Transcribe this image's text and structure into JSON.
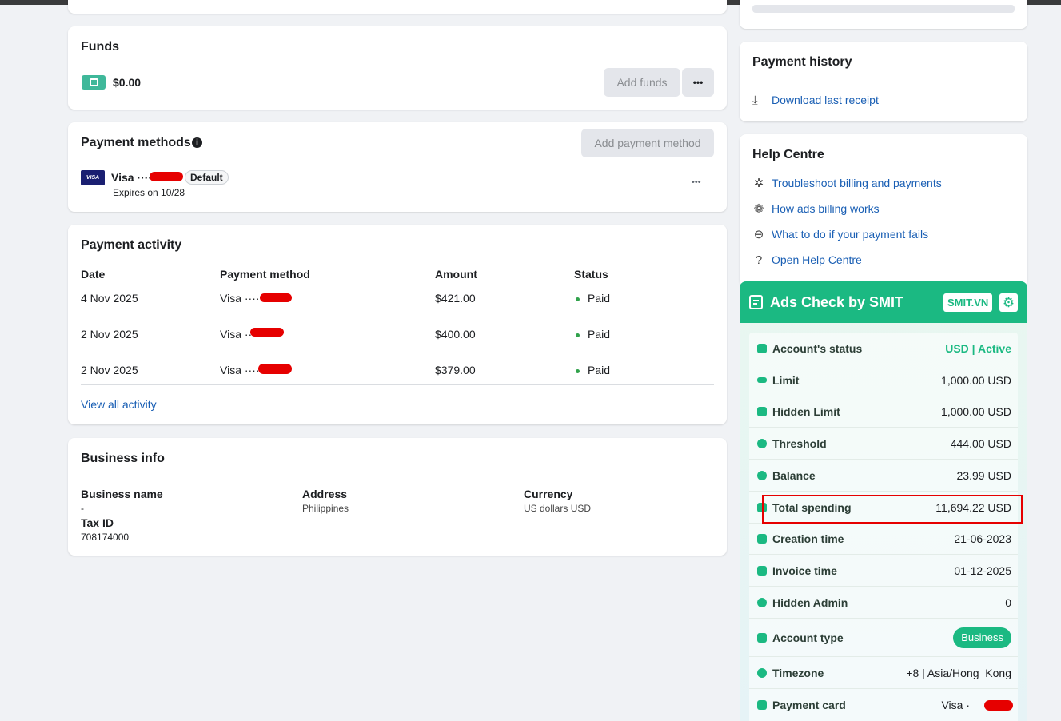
{
  "funds": {
    "title": "Funds",
    "amount": "$0.00",
    "add_funds_label": "Add funds",
    "more_label": "•••"
  },
  "payment_methods": {
    "title": "Payment methods",
    "add_label": "Add payment method",
    "card_brand_badge": "VISA",
    "card_name": "Visa ····",
    "default_badge": "Default",
    "expiry": "Expires on 10/28",
    "more_label": "•••"
  },
  "payment_activity": {
    "title": "Payment activity",
    "columns": [
      "Date",
      "Payment method",
      "Amount",
      "Status"
    ],
    "rows": [
      {
        "date": "4 Nov 2025",
        "method": "Visa ····",
        "amount": "$421.00",
        "status": "Paid"
      },
      {
        "date": "2 Nov 2025",
        "method": "Visa ····",
        "amount": "$400.00",
        "status": "Paid"
      },
      {
        "date": "2 Nov 2025",
        "method": "Visa ····",
        "amount": "$379.00",
        "status": "Paid"
      }
    ],
    "view_all_label": "View all activity"
  },
  "business_info": {
    "title": "Business info",
    "business_name_label": "Business name",
    "business_name_value": "-",
    "tax_id_label": "Tax ID",
    "tax_id_value": "708174000",
    "address_label": "Address",
    "address_value": "Philippines",
    "currency_label": "Currency",
    "currency_value": "US dollars USD"
  },
  "payment_history": {
    "title": "Payment history",
    "download_label": "Download last receipt"
  },
  "help_centre": {
    "title": "Help Centre",
    "links": [
      {
        "label": "Troubleshoot billing and payments",
        "icon": "tools-icon"
      },
      {
        "label": "How ads billing works",
        "icon": "circles-icon"
      },
      {
        "label": "What to do if your payment fails",
        "icon": "minus-circle-icon"
      },
      {
        "label": "Open Help Centre",
        "icon": "question-circle-icon"
      }
    ]
  },
  "smit": {
    "title": "Ads Check by SMIT",
    "badge": "SMIT.VN",
    "accent": "#1bb982",
    "rows": [
      {
        "label": "Account's status",
        "value": "USD | Active"
      },
      {
        "label": "Limit",
        "value": "1,000.00 USD"
      },
      {
        "label": "Hidden Limit",
        "value": "1,000.00 USD"
      },
      {
        "label": "Threshold",
        "value": "444.00 USD"
      },
      {
        "label": "Balance",
        "value": "23.99 USD"
      },
      {
        "label": "Total spending",
        "value": "11,694.22 USD"
      },
      {
        "label": "Creation time",
        "value": "21-06-2023"
      },
      {
        "label": "Invoice time",
        "value": "01-12-2025"
      },
      {
        "label": "Hidden Admin",
        "value": "0"
      },
      {
        "label": "Account type",
        "value": "Business"
      },
      {
        "label": "Timezone",
        "value": "+8 | Asia/Hong_Kong"
      },
      {
        "label": "Payment card",
        "value": "Visa ·"
      }
    ]
  }
}
